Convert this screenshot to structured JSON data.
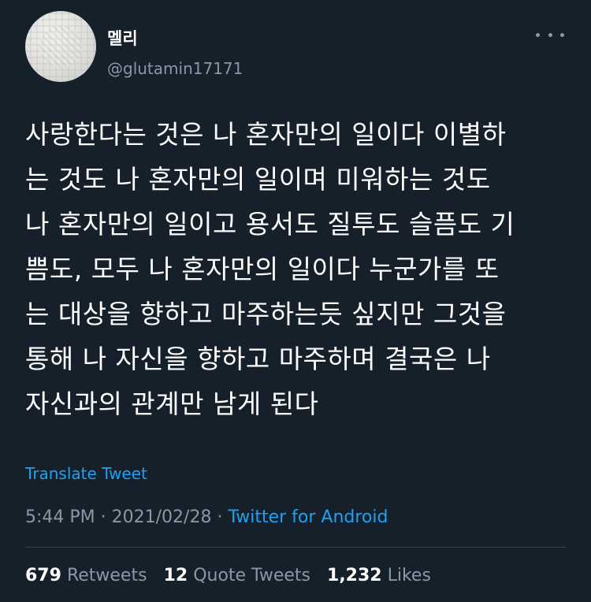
{
  "author": {
    "display_name": "멜리",
    "handle": "@glutamin17171"
  },
  "tweet": {
    "text": "사랑한다는 것은 나 혼자만의 일이다 이별하\n는 것도 나 혼자만의 일이며 미워하는 것도\n나 혼자만의 일이고 용서도 질투도 슬픔도 기\n쁨도, 모두 나 혼자만의 일이다 누군가를 또\n는 대상을 향하고 마주하는듯 싶지만 그것을\n통해 나 자신을 향하고 마주하며 결국은 나\n자신과의 관계만 남게 된다",
    "translate_label": "Translate Tweet",
    "time": "5:44 PM",
    "separator": " · ",
    "date": "2021/02/28",
    "source": "Twitter for Android"
  },
  "stats": {
    "retweets_count": "679",
    "retweets_label": "Retweets",
    "quote_count": "12",
    "quote_label": "Quote Tweets",
    "likes_count": "1,232",
    "likes_label": "Likes"
  },
  "icons": {
    "more": "more-horizontal-icon"
  }
}
